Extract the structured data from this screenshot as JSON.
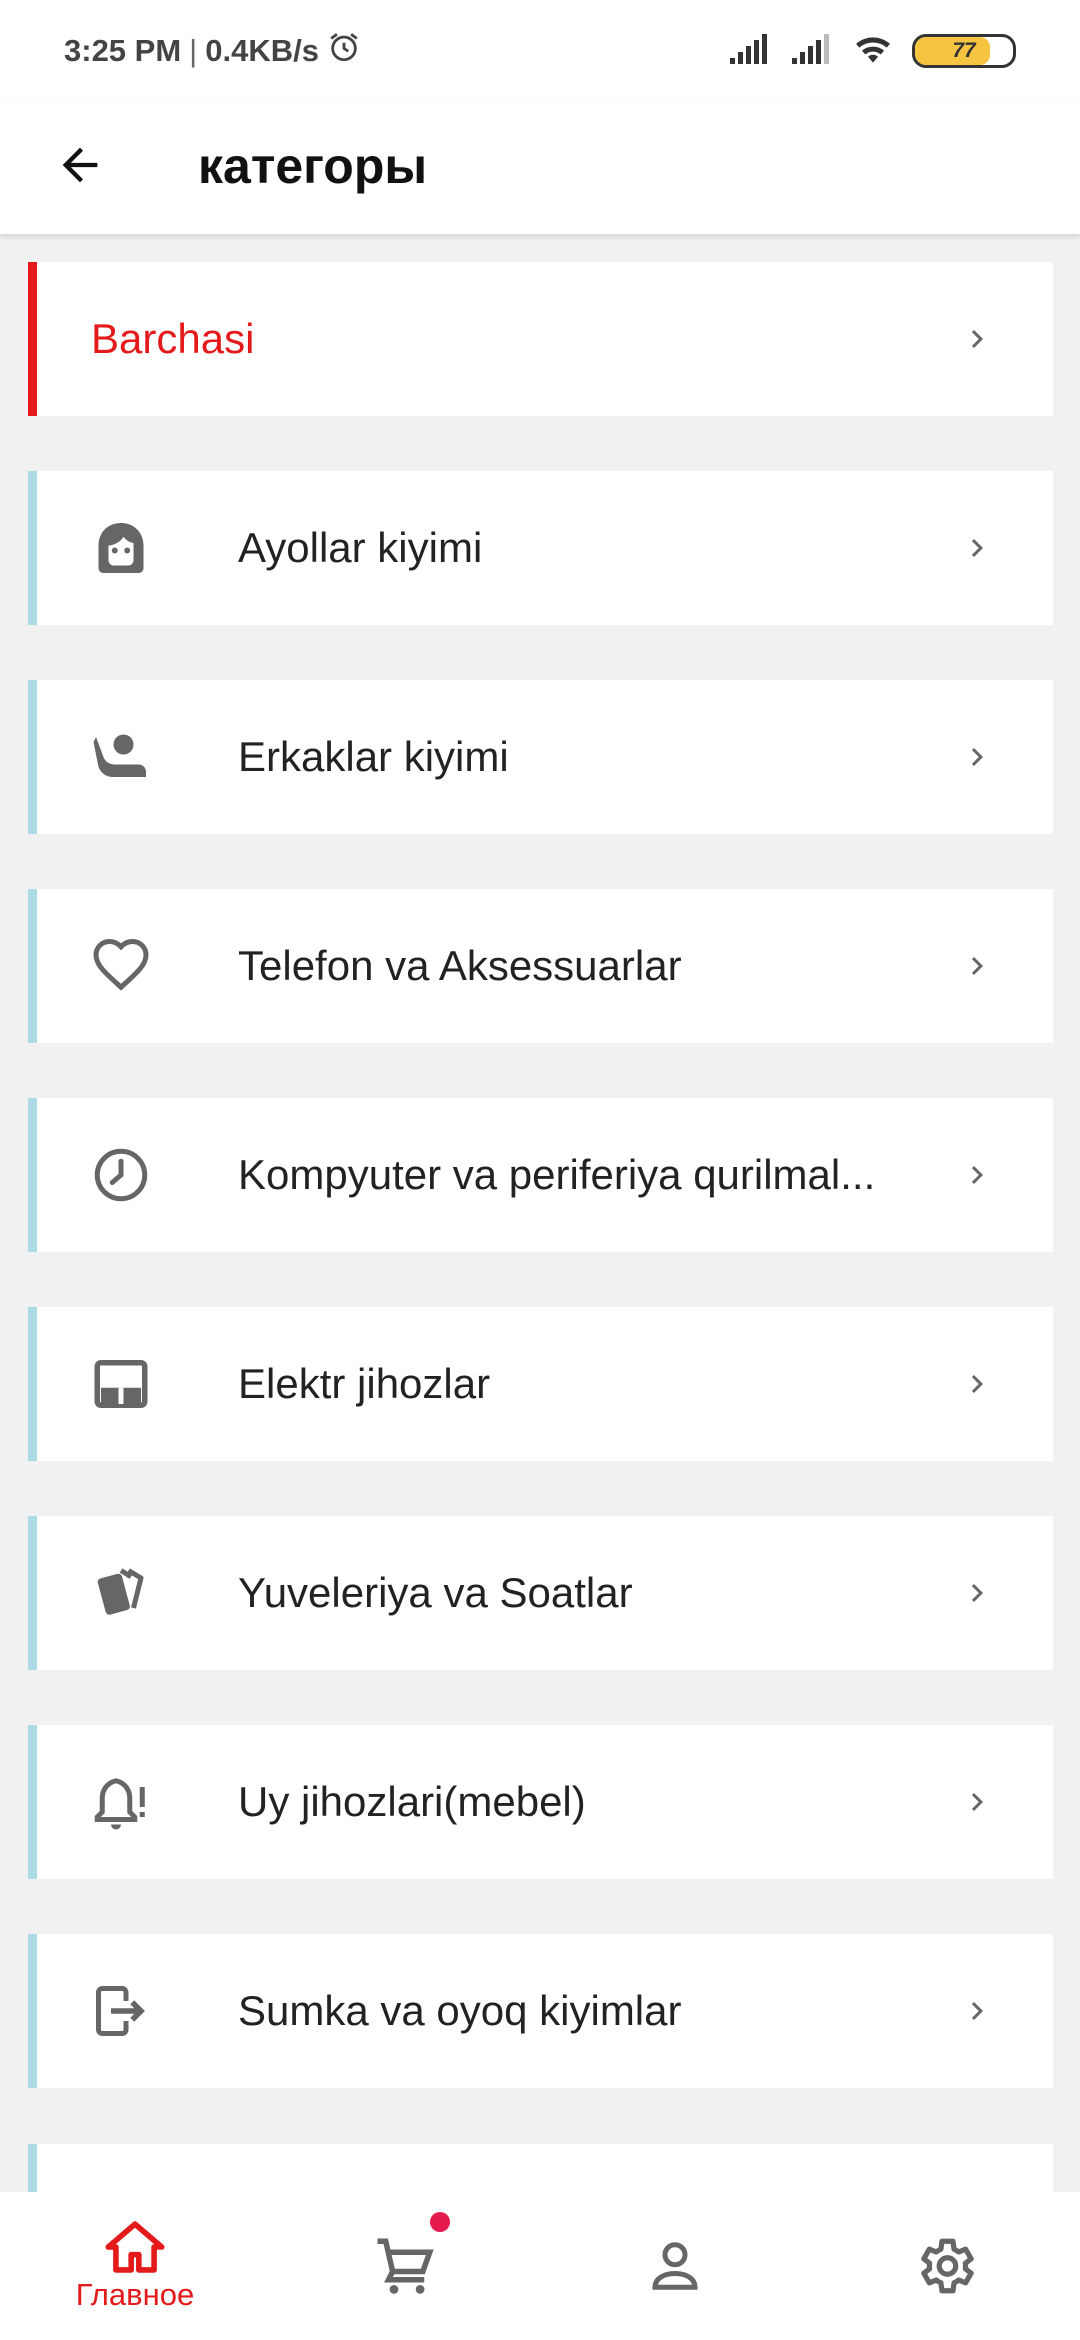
{
  "status_bar": {
    "time": "3:25 PM",
    "separator": "|",
    "speed": "0.4KB/s",
    "battery": "77",
    "icons": [
      "alarm-icon",
      "signal-icon",
      "signal-icon",
      "wifi-icon",
      "battery-icon"
    ]
  },
  "header": {
    "title": "категоры",
    "back_icon": "arrow-left-icon"
  },
  "categories": [
    {
      "label": "Barchasi",
      "active": true,
      "icon": null
    },
    {
      "label": "Ayollar kiyimi",
      "icon": "face-woman-icon"
    },
    {
      "label": "Erkaklar kiyimi",
      "icon": "person-reclining-icon"
    },
    {
      "label": "Telefon va Aksessuarlar",
      "icon": "heart-icon"
    },
    {
      "label": "Kompyuter va periferiya qurilmal...",
      "icon": "clock-icon"
    },
    {
      "label": "Elektr jihozlar",
      "icon": "tablet-icon"
    },
    {
      "label": "Yuveleriya va Soatlar",
      "icon": "cards-icon"
    },
    {
      "label": "Uy jihozlari(mebel)",
      "icon": "bell-alert-icon"
    },
    {
      "label": "Sumka va oyoq kiyimlar",
      "icon": "logout-icon"
    }
  ],
  "bottom_nav": {
    "home_label": "Главное",
    "items": [
      "home-icon",
      "cart-icon",
      "user-icon",
      "gear-icon"
    ]
  },
  "colors": {
    "accent": "#e41a1a",
    "inactive_bar": "#acdbe6",
    "icon_gray": "#666666",
    "background": "#f1f1f1"
  }
}
